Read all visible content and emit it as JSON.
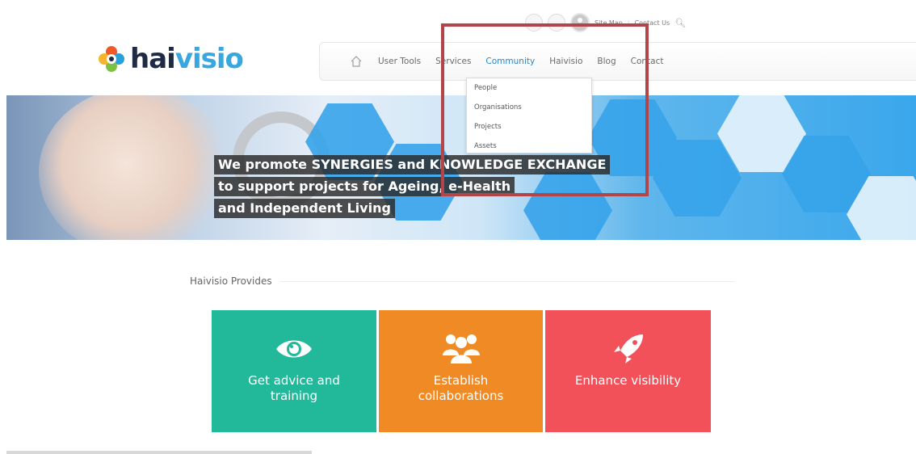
{
  "utility": {
    "links": [
      "Site Map",
      "Contact Us"
    ]
  },
  "logo": {
    "prefix": "hai",
    "accent": "visio"
  },
  "nav": {
    "home_icon": "home-icon",
    "items": [
      "User Tools",
      "Services",
      "Community",
      "Haivisio",
      "Blog",
      "Contact"
    ],
    "active": "Community"
  },
  "dropdown": {
    "items": [
      "People",
      "Organisations",
      "Projects",
      "Assets"
    ]
  },
  "hero": {
    "lines": [
      "We promote SYNERGIES and KNOWLEDGE EXCHANGE",
      "to support projects for Ageing, e-Health",
      "and Independent Living"
    ]
  },
  "provides": {
    "title": "Haivisio Provides",
    "cards": [
      {
        "label": "Get advice and\ntraining",
        "icon": "eye-icon",
        "color": "#22b99a"
      },
      {
        "label": "Establish\ncollaborations",
        "icon": "people-icon",
        "color": "#f08a24"
      },
      {
        "label": "Enhance visibility",
        "icon": "rocket-icon",
        "color": "#f2515a"
      }
    ]
  },
  "colors": {
    "highlight": "#b24548",
    "nav_active": "#2c86c7",
    "brand_dark": "#1f2a44",
    "brand_accent": "#3aa6e0"
  }
}
